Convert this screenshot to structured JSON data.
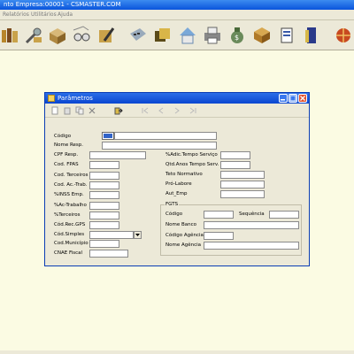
{
  "app": {
    "title": "nto  Empresa:00001 - CSMASTER.COM",
    "menu": [
      "Relatórios",
      "Utilitários",
      "Ajuda"
    ]
  },
  "toolbar": {
    "icons": [
      "books-icon",
      "wrench-icon",
      "box-icon",
      "glasses-icon",
      "pencil-book-icon",
      "calculator-icon",
      "folders-icon",
      "house-icon",
      "printer-icon",
      "moneybag-icon",
      "package-icon",
      "document-icon",
      "door-icon",
      "globe-icon"
    ]
  },
  "dialog": {
    "title": "Parâmetros",
    "fields_left": [
      {
        "label": "Código",
        "value": ""
      },
      {
        "label": "Nome Resp.",
        "value": ""
      },
      {
        "label": "CPF Resp.",
        "value": ""
      },
      {
        "label": "Cod. FPAS",
        "value": ""
      },
      {
        "label": "Cod. Terceiros",
        "value": ""
      },
      {
        "label": "Cod. Ac.-Trab.",
        "value": ""
      },
      {
        "label": "%INSS Emp.",
        "value": ""
      },
      {
        "label": "%Ac-Trabalho",
        "value": ""
      },
      {
        "label": "%Terceiros",
        "value": ""
      },
      {
        "label": "Cód.Rec.GPS",
        "value": ""
      },
      {
        "label": "Cód.Simples",
        "value": ""
      },
      {
        "label": "Cod.Município",
        "value": ""
      },
      {
        "label": "CNAE Fiscal",
        "value": ""
      }
    ],
    "fields_right": [
      {
        "label": "%Adic.Tempo Serviço",
        "value": ""
      },
      {
        "label": "Qtd.Anos Tempo Serv.",
        "value": ""
      },
      {
        "label": "Teto Normativo",
        "value": ""
      },
      {
        "label": "Pró-Labore",
        "value": ""
      },
      {
        "label": "Aut_Emp",
        "value": ""
      }
    ],
    "fgts": {
      "title": "FGTS",
      "codigo_label": "Código",
      "sequencia_label": "Sequência",
      "nome_banco_label": "Nome Banco",
      "codigo_agencia_label": "Código Agência",
      "nome_agencia_label": "Nome Agência"
    }
  }
}
